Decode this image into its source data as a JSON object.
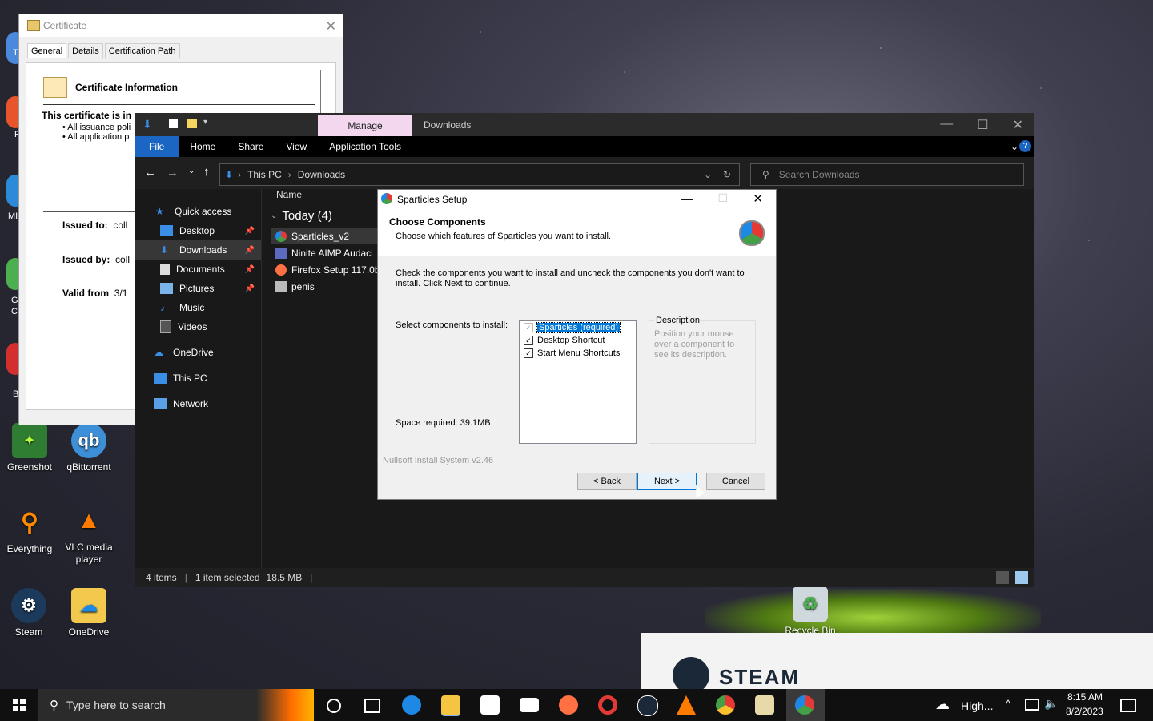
{
  "desktop": {
    "icons": [
      {
        "label": "Greenshot"
      },
      {
        "label": "qBittorrent"
      },
      {
        "label": "Everything"
      },
      {
        "label": "VLC media player"
      },
      {
        "label": "Steam"
      },
      {
        "label": "OneDrive"
      },
      {
        "label": "Recycle Bin"
      }
    ],
    "left_edge_labels": [
      "T",
      "F",
      "MI",
      "G C",
      "B"
    ]
  },
  "certificate": {
    "title": "Certificate",
    "tabs": [
      "General",
      "Details",
      "Certification Path"
    ],
    "header": "Certificate Information",
    "intro": "This certificate is in",
    "bullets": [
      "• All issuance poli",
      "• All application p"
    ],
    "issued_to_label": "Issued to:",
    "issued_to_value": "coll",
    "issued_by_label": "Issued by:",
    "issued_by_value": "coll",
    "valid_from_label": "Valid from",
    "valid_from_value": "3/1"
  },
  "explorer": {
    "manage_tab": "Manage",
    "window_title": "Downloads",
    "ribbon": {
      "file": "File",
      "home": "Home",
      "share": "Share",
      "view": "View",
      "tools": "Application Tools"
    },
    "breadcrumb": [
      "This PC",
      "Downloads"
    ],
    "search_placeholder": "Search Downloads",
    "nav": {
      "quick_access": "Quick access",
      "desktop": "Desktop",
      "downloads": "Downloads",
      "documents": "Documents",
      "pictures": "Pictures",
      "music": "Music",
      "videos": "Videos",
      "onedrive": "OneDrive",
      "thispc": "This PC",
      "network": "Network"
    },
    "column_name": "Name",
    "group": "Today (4)",
    "files": [
      "Sparticles_v2",
      "Ninite AIMP Audaci",
      "Firefox Setup 117.0b",
      "penis"
    ],
    "status": {
      "items": "4 items",
      "selected": "1 item selected",
      "size": "18.5 MB"
    }
  },
  "setup": {
    "title": "Sparticles Setup",
    "header_title": "Choose Components",
    "header_sub": "Choose which features of Sparticles you want to install.",
    "instructions": "Check the components you want to install and uncheck the components you don't want to install. Click Next to continue.",
    "select_label": "Select components to install:",
    "components": [
      {
        "label": "Sparticles (required)",
        "checked": true
      },
      {
        "label": "Desktop Shortcut",
        "checked": true
      },
      {
        "label": "Start Menu Shortcuts",
        "checked": true
      }
    ],
    "description_title": "Description",
    "description_text": "Position your mouse over a component to see its description.",
    "space_required": "Space required: 39.1MB",
    "branding": "Nullsoft Install System v2.46",
    "back_label": "< Back",
    "next_label": "Next >",
    "cancel_label": "Cancel"
  },
  "steam_popup": {
    "wordmark": "STEAM"
  },
  "taskbar": {
    "search_placeholder": "Type here to search",
    "weather": "High...",
    "time": "8:15 AM",
    "date": "8/2/2023"
  }
}
